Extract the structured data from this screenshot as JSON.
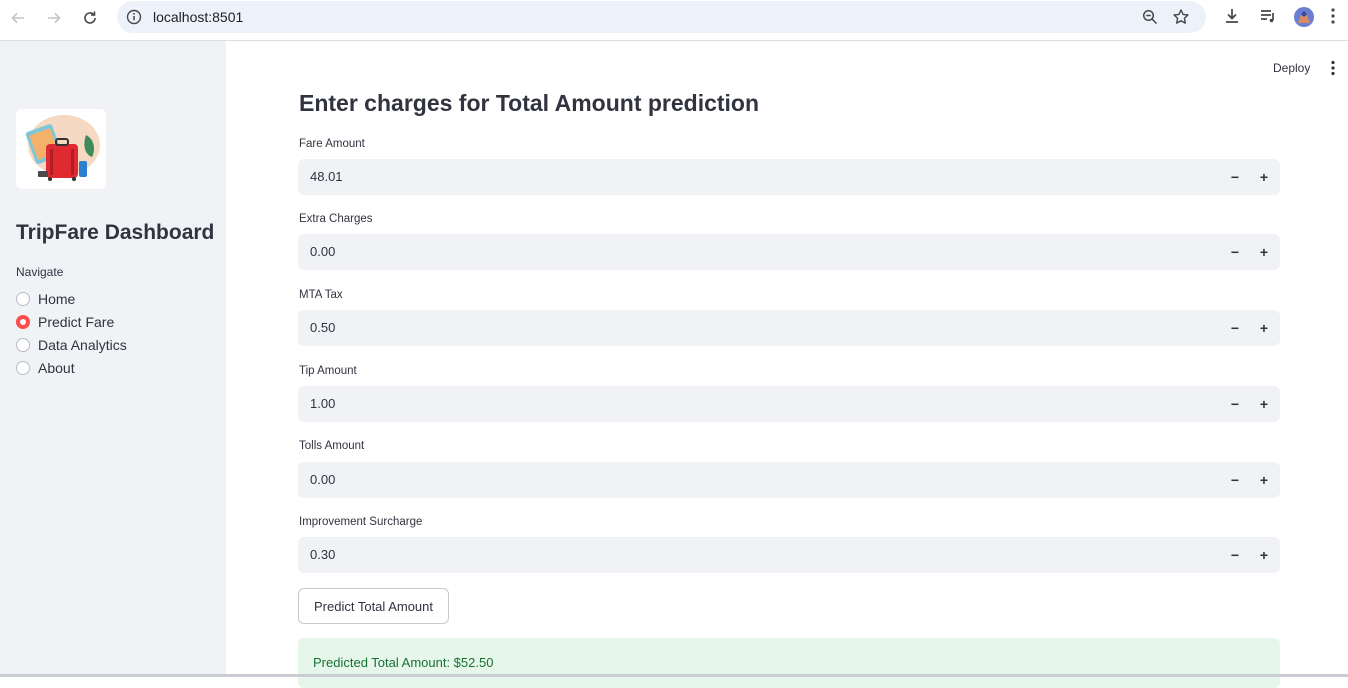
{
  "browser": {
    "url": "localhost:8501"
  },
  "sidebar": {
    "title": "TripFare Dashboard",
    "nav_label": "Navigate",
    "nav_items": [
      {
        "label": "Home",
        "selected": false
      },
      {
        "label": "Predict Fare",
        "selected": true
      },
      {
        "label": "Data Analytics",
        "selected": false
      },
      {
        "label": "About",
        "selected": false
      }
    ]
  },
  "header": {
    "deploy_label": "Deploy"
  },
  "main": {
    "title": "Enter charges for Total Amount prediction",
    "fields": [
      {
        "label": "Fare Amount",
        "value": "48.01"
      },
      {
        "label": "Extra Charges",
        "value": "0.00"
      },
      {
        "label": "MTA Tax",
        "value": "0.50"
      },
      {
        "label": "Tip Amount",
        "value": "1.00"
      },
      {
        "label": "Tolls Amount",
        "value": "0.00"
      },
      {
        "label": "Improvement Surcharge",
        "value": "0.30"
      }
    ],
    "stepper_minus": "−",
    "stepper_plus": "+",
    "predict_button": "Predict Total Amount",
    "result_text": "Predicted Total Amount: $52.50"
  },
  "colors": {
    "accent": "#ff4b4b",
    "sidebar_bg": "#f0f2f6",
    "success_bg": "#e6f6ea",
    "success_text": "#177233"
  }
}
